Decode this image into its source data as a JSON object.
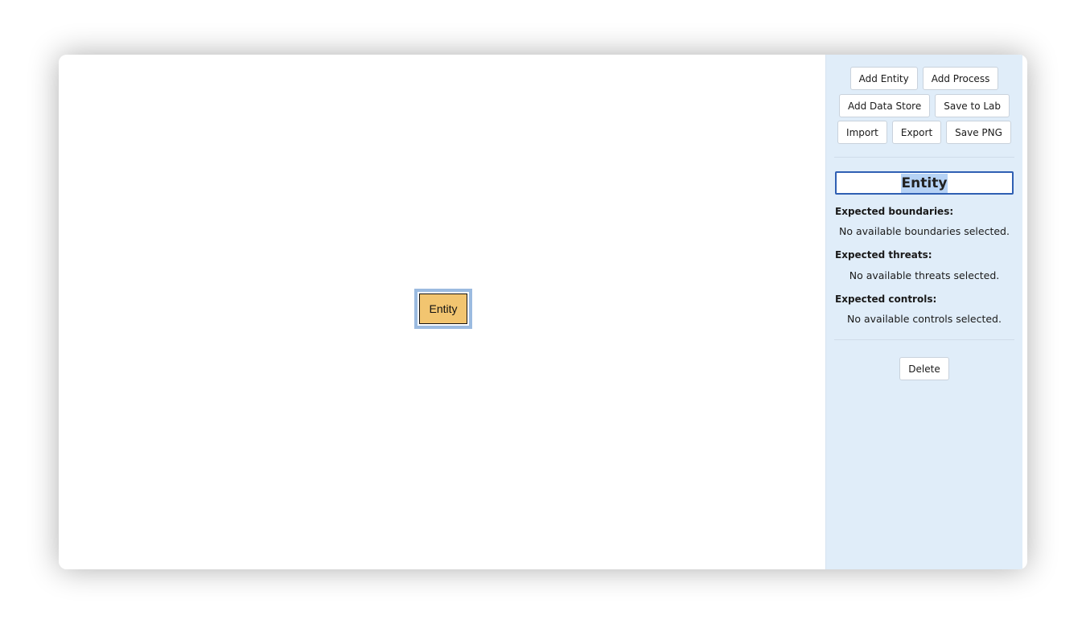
{
  "toolbar": {
    "add_entity": "Add Entity",
    "add_process": "Add Process",
    "add_data_store": "Add Data Store",
    "save_to_lab": "Save to Lab",
    "import": "Import",
    "export": "Export",
    "save_png": "Save PNG"
  },
  "canvas": {
    "node_label": "Entity"
  },
  "properties": {
    "title_value": "Entity",
    "boundaries_label": "Expected boundaries:",
    "boundaries_value": "No available boundaries selected.",
    "threats_label": "Expected threats:",
    "threats_value": "No available threats selected.",
    "controls_label": "Expected controls:",
    "controls_value": "No available controls selected.",
    "delete": "Delete"
  },
  "colors": {
    "sidebar_bg": "#e0edf9",
    "entity_fill": "#f2c570",
    "selection_outline": "#9bbbe0",
    "input_border": "#2f5fb3"
  }
}
